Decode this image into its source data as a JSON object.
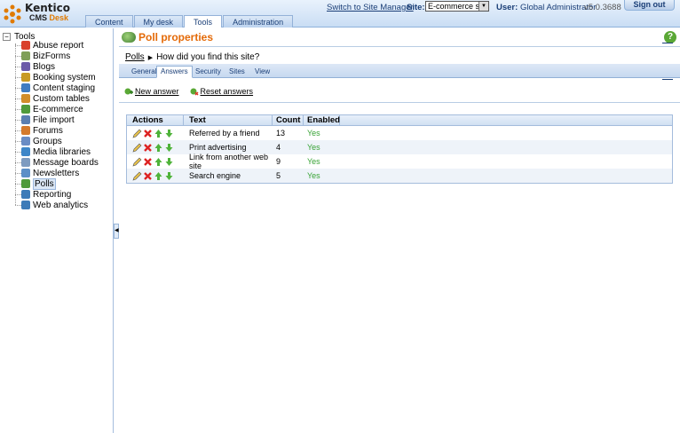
{
  "header": {
    "logo_line1": "Kentico",
    "logo_line2a": "CMS",
    "logo_line2b": "Desk",
    "tabs": [
      {
        "label": "Content",
        "active": false
      },
      {
        "label": "My desk",
        "active": false
      },
      {
        "label": "Tools",
        "active": true
      },
      {
        "label": "Administration",
        "active": false
      }
    ],
    "switch_link": "Switch to Site Manager",
    "site_label": "Site:",
    "site_value": "E-commerce site",
    "user_label": "User:",
    "user_value": "Global Administrator",
    "version": "v5.0.3688",
    "signout": "Sign out"
  },
  "tree": {
    "root": "Tools",
    "items": [
      {
        "label": "Abuse report",
        "icon": "abuse-report-icon",
        "color": "#d9402b"
      },
      {
        "label": "BizForms",
        "icon": "bizforms-icon",
        "color": "#7f9f58"
      },
      {
        "label": "Blogs",
        "icon": "blogs-icon",
        "color": "#6b5aa8"
      },
      {
        "label": "Booking system",
        "icon": "booking-icon",
        "color": "#c89a24"
      },
      {
        "label": "Content staging",
        "icon": "staging-icon",
        "color": "#3f7cc2"
      },
      {
        "label": "Custom tables",
        "icon": "tables-icon",
        "color": "#d18d2a"
      },
      {
        "label": "E-commerce",
        "icon": "ecommerce-icon",
        "color": "#4f9a3b"
      },
      {
        "label": "File import",
        "icon": "file-import-icon",
        "color": "#5a7fb1"
      },
      {
        "label": "Forums",
        "icon": "forums-icon",
        "color": "#d47a2c"
      },
      {
        "label": "Groups",
        "icon": "groups-icon",
        "color": "#6a8cc4"
      },
      {
        "label": "Media libraries",
        "icon": "media-icon",
        "color": "#3e86c8"
      },
      {
        "label": "Message boards",
        "icon": "boards-icon",
        "color": "#7d9bc0"
      },
      {
        "label": "Newsletters",
        "icon": "newsletter-icon",
        "color": "#5c8fc7"
      },
      {
        "label": "Polls",
        "icon": "polls-icon",
        "color": "#4f9a3b",
        "selected": true
      },
      {
        "label": "Reporting",
        "icon": "reporting-icon",
        "color": "#3d7bb8"
      },
      {
        "label": "Web analytics",
        "icon": "analytics-icon",
        "color": "#3d7bb8"
      }
    ]
  },
  "page": {
    "title": "Poll properties",
    "breadcrumb_link": "Polls",
    "breadcrumb_current": "How did you find this site?",
    "subtabs": [
      "General",
      "Answers",
      "Security",
      "Sites",
      "View"
    ],
    "active_subtab": "Answers",
    "new_answer": "New answer",
    "reset_answers": "Reset answers"
  },
  "grid": {
    "headers": [
      "Actions",
      "Text",
      "Count",
      "Enabled"
    ],
    "rows": [
      {
        "text": "Referred by a friend",
        "count": "13",
        "enabled": "Yes"
      },
      {
        "text": "Print advertising",
        "count": "4",
        "enabled": "Yes"
      },
      {
        "text": "Link from another web site",
        "count": "9",
        "enabled": "Yes"
      },
      {
        "text": "Search engine",
        "count": "5",
        "enabled": "Yes"
      }
    ]
  }
}
